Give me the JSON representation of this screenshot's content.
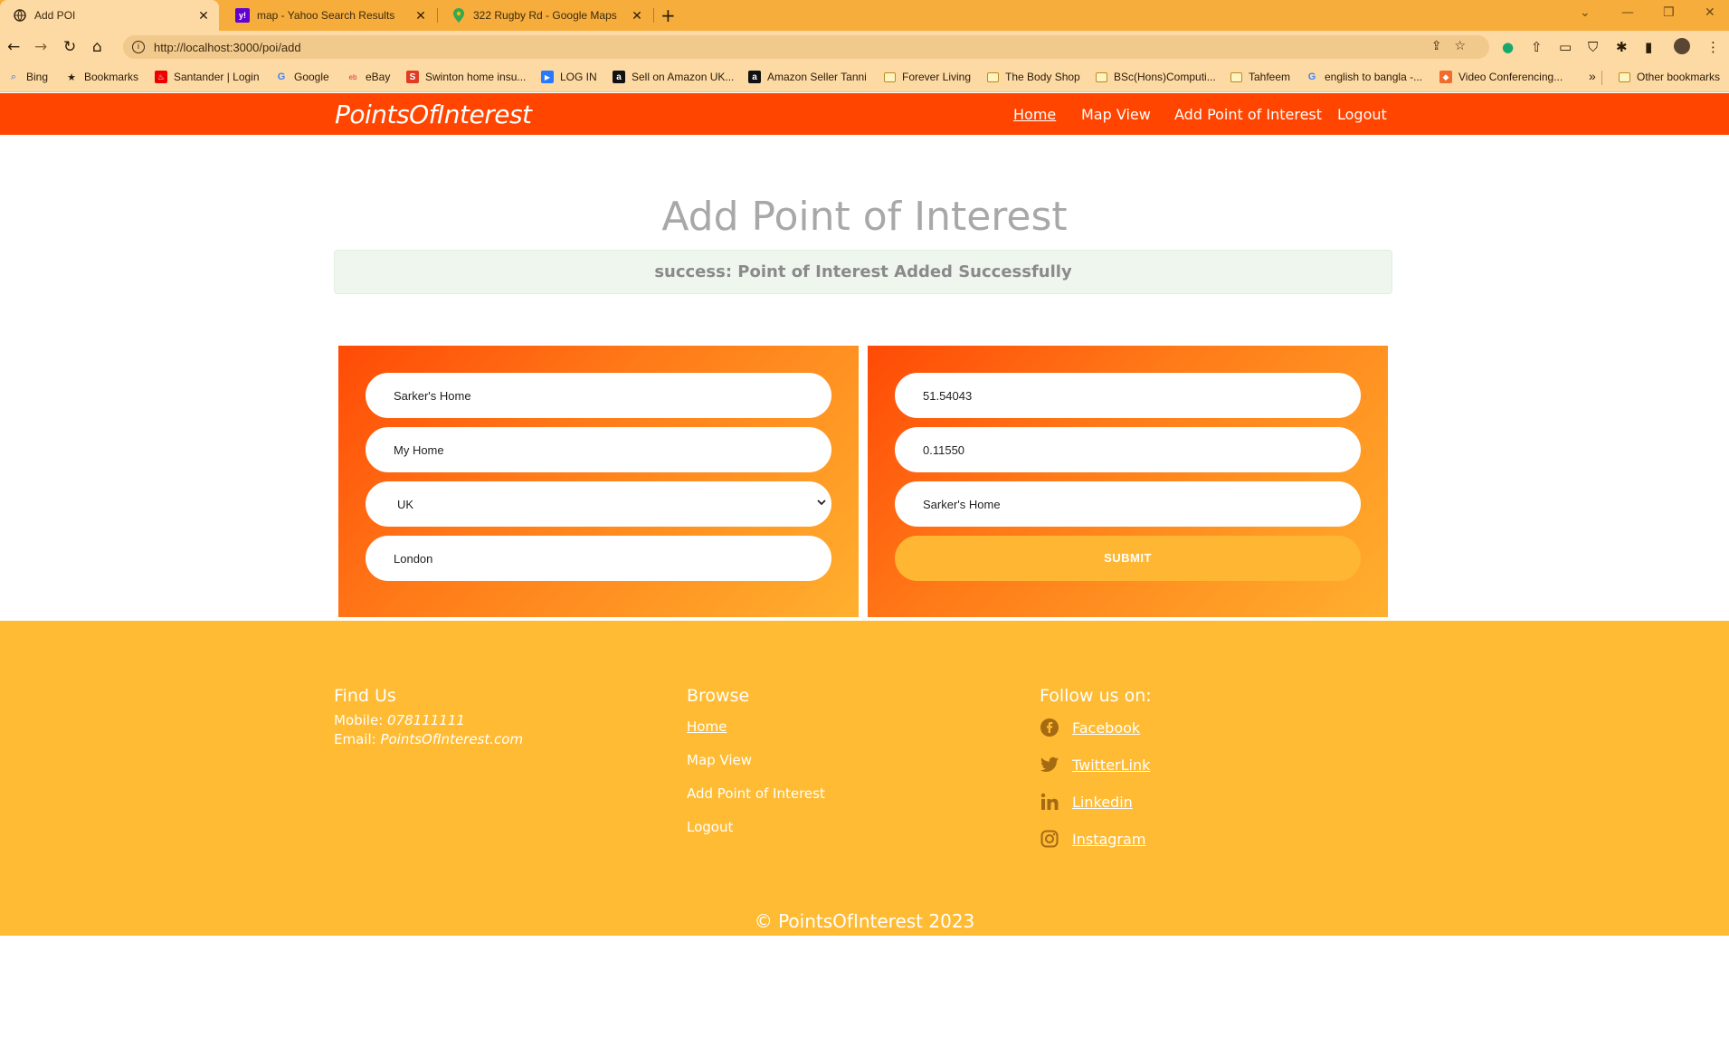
{
  "browser": {
    "tabs": [
      {
        "title": "Add POI",
        "active": true
      },
      {
        "title": "map - Yahoo Search Results",
        "active": false
      },
      {
        "title": "322 Rugby Rd - Google Maps",
        "active": false
      }
    ],
    "url": "http://localhost:3000/poi/add",
    "bookmarks": [
      {
        "label": "Bing",
        "icon": "search-icon"
      },
      {
        "label": "Bookmarks",
        "icon": "star-icon"
      },
      {
        "label": "Santander | Login",
        "icon": "santander-icon"
      },
      {
        "label": "Google",
        "icon": "google-icon"
      },
      {
        "label": "eBay",
        "icon": "ebay-icon"
      },
      {
        "label": "Swinton home insu...",
        "icon": "swinton-icon"
      },
      {
        "label": "LOG IN",
        "icon": "play-icon"
      },
      {
        "label": "Sell on Amazon UK...",
        "icon": "amazon-icon"
      },
      {
        "label": "Amazon Seller Tanni",
        "icon": "amazon-icon"
      },
      {
        "label": "Forever Living",
        "icon": "folder-icon"
      },
      {
        "label": "The Body Shop",
        "icon": "folder-icon"
      },
      {
        "label": "BSc(Hons)Computi...",
        "icon": "folder-icon"
      },
      {
        "label": "Tahfeem",
        "icon": "folder-icon"
      },
      {
        "label": "english to bangla -...",
        "icon": "google-icon"
      },
      {
        "label": "Video Conferencing...",
        "icon": "cube-icon"
      }
    ],
    "overflow_label": "»",
    "other_bookmarks": "Other bookmarks"
  },
  "app": {
    "brand": "PointsOfInterest",
    "nav": [
      "Home",
      "Map View",
      "Add Point of Interest",
      "Logout"
    ]
  },
  "main": {
    "title": "Add Point of Interest",
    "alert": "success: Point of Interest Added Successfully",
    "left_fields": {
      "name": "Sarker's Home",
      "description": "My Home",
      "country": "UK",
      "city": "London"
    },
    "right_fields": {
      "latitude": "51.54043",
      "longitude": "0.11550",
      "label": "Sarker's Home"
    },
    "submit_label": "SUBMIT"
  },
  "footer": {
    "find_us_heading": "Find Us",
    "mobile_label": "Mobile:",
    "mobile_value": "078111111",
    "email_label": "Email:",
    "email_value": "PointsOfInterest.com",
    "browse_heading": "Browse",
    "browse_links": [
      "Home",
      "Map View",
      "Add Point of Interest",
      "Logout"
    ],
    "follow_heading": "Follow us on:",
    "social": [
      {
        "label": "Facebook",
        "icon": "facebook-icon"
      },
      {
        "label": "TwitterLink",
        "icon": "twitter-icon"
      },
      {
        "label": "Linkedin",
        "icon": "linkedin-icon"
      },
      {
        "label": "Instagram",
        "icon": "instagram-icon"
      }
    ],
    "copyright": "© PointsOfInterest 2023"
  },
  "colors": {
    "nav_bar": "#ff4500",
    "footer": "#ffbb33",
    "submit": "#ffb733",
    "alert_bg": "#eef6ee"
  }
}
